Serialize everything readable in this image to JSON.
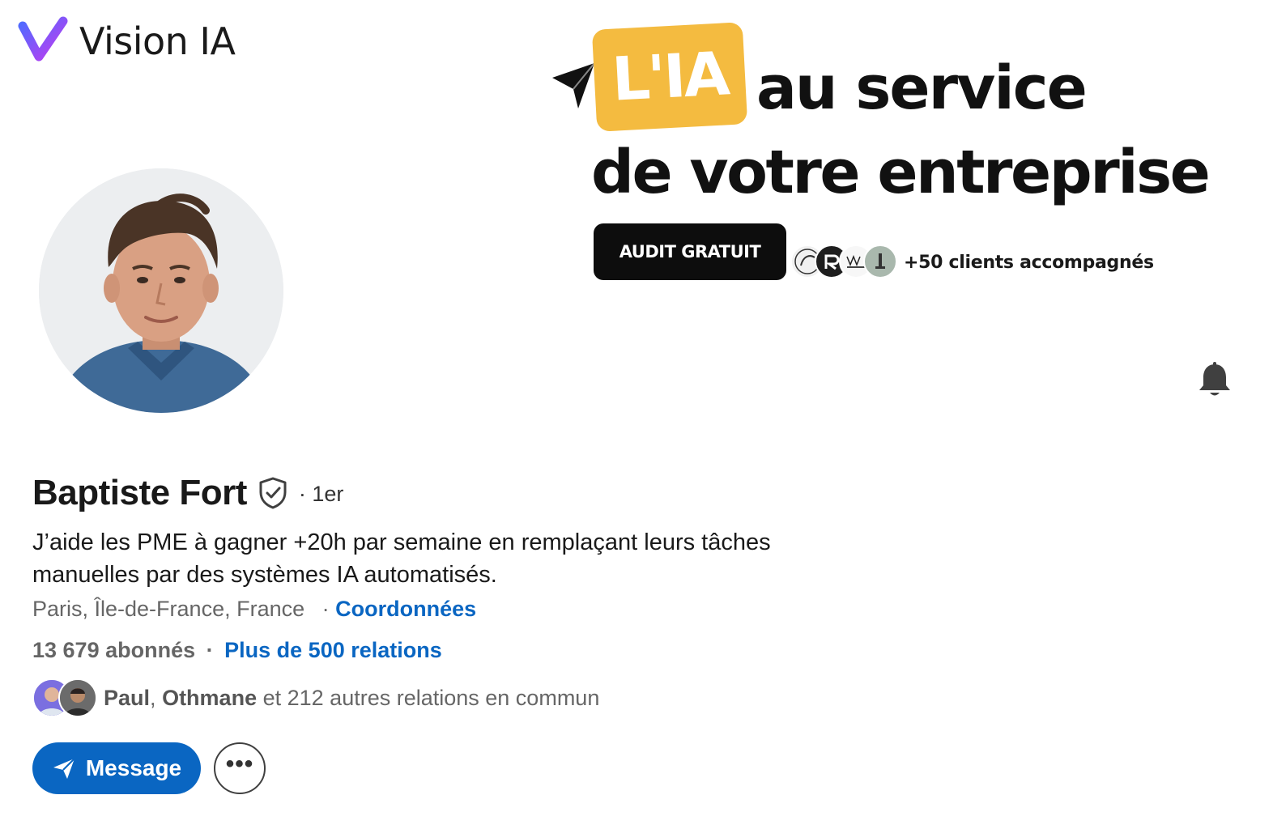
{
  "banner": {
    "brand_name": "Vision IA",
    "tag": "L'IA",
    "headline_line1": "au service",
    "headline_line2": "de votre entreprise",
    "audit_button": "AUDIT GRATUIT",
    "clients_text": "+50 clients accompagnés",
    "colors": {
      "tag": "#f4bb40",
      "audit_button": "#0d0d0d",
      "logo_gradient_start": "#4f6bff",
      "logo_gradient_end": "#c13bf0"
    },
    "icons": [
      "vision-ia-logo-icon",
      "pointer-arrow-icon"
    ]
  },
  "profile": {
    "name": "Baptiste Fort",
    "degree": "· 1er",
    "headline": "J’aide les PME à gagner +20h par semaine en remplaçant leurs tâches manuelles par des systèmes IA automatisés.",
    "location": "Paris, Île-de-France, France",
    "location_separator": "·",
    "contact_link": "Coordonnées",
    "followers": "13 679 abonnés",
    "stats_separator": "·",
    "connections_link": "Plus de 500 relations",
    "mutual": {
      "name1": "Paul",
      "separator": ",",
      "name2": "Othmane",
      "rest": "et 212 autres relations en commun"
    }
  },
  "actions": {
    "message_label": "Message",
    "more_icon": "•••",
    "icons": [
      "bell-icon",
      "send-icon",
      "more-icon",
      "verified-icon"
    ]
  },
  "colors": {
    "accent": "#0a66c2",
    "text": "#191919",
    "muted": "#666666"
  }
}
